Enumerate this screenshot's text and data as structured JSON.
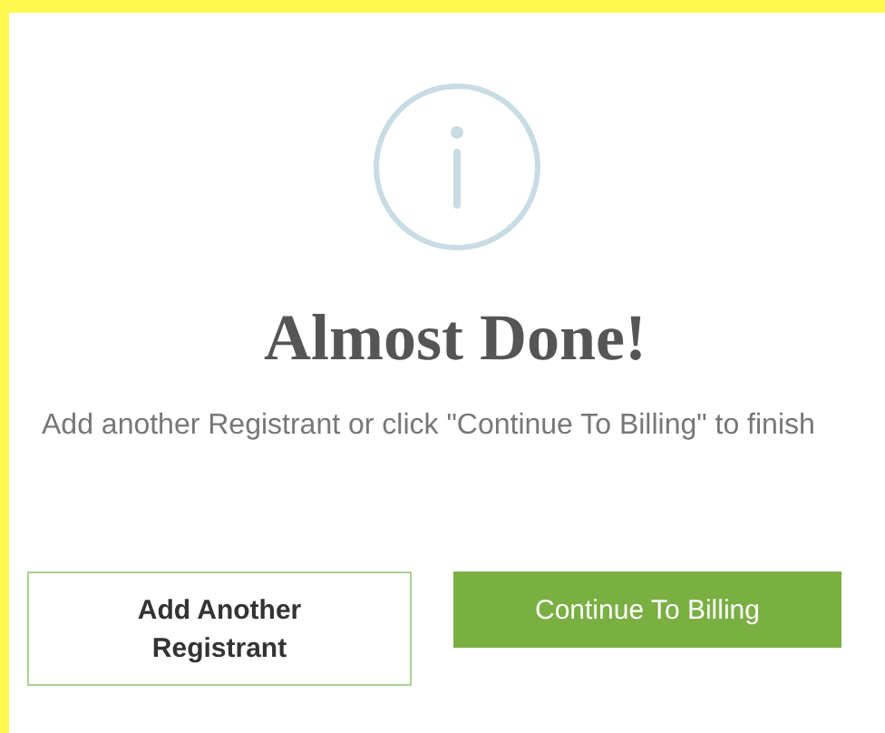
{
  "dialog": {
    "title": "Almost Done!",
    "message": "Add another Registrant or click \"Continue To Billing\" to finish"
  },
  "buttons": [
    {
      "label": "Add Another Registrant",
      "kind": "outline"
    },
    {
      "label": "Continue To Billing",
      "kind": "primary"
    }
  ]
}
